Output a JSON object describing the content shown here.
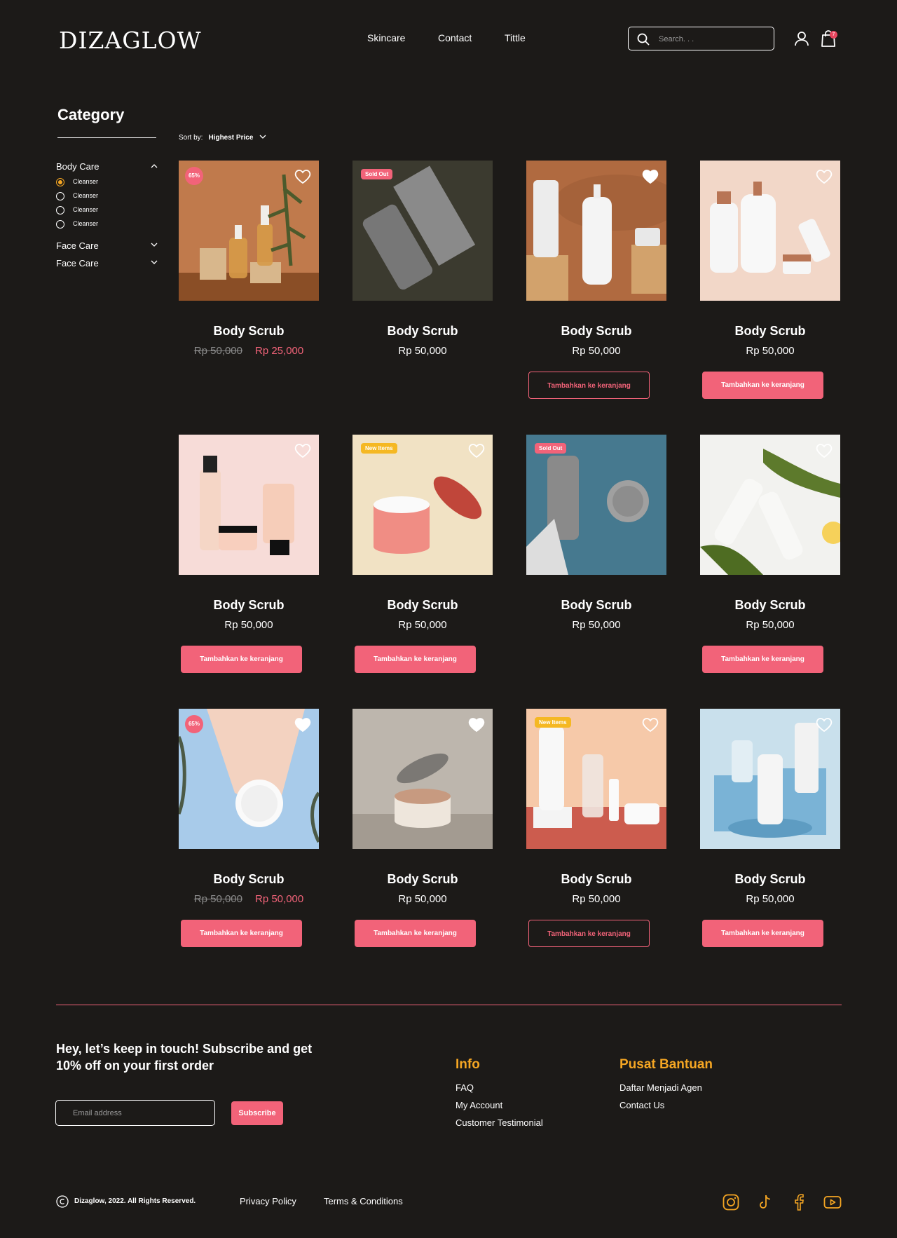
{
  "header": {
    "logo": "DIZAGLOW",
    "nav": [
      "Skincare",
      "Contact",
      "Tittle"
    ],
    "search_placeholder": "Search. . .",
    "cart_count": "7"
  },
  "sidebar": {
    "title": "Category",
    "groups": [
      {
        "label": "Body Care",
        "expanded": true,
        "options": [
          "Cleanser",
          "Cleanser",
          "Cleanser",
          "Cleanser"
        ],
        "selected_index": 0
      },
      {
        "label": "Face Care",
        "expanded": false
      },
      {
        "label": "Face Care",
        "expanded": false
      }
    ]
  },
  "sort": {
    "label": "Sort by:",
    "value": "Highest Price"
  },
  "products": [
    {
      "name": "Body Scrub",
      "old_price": "Rp 50,000",
      "price": "Rp 25,000",
      "badge": "65%",
      "badge_type": "pct",
      "favorited": false,
      "button": null
    },
    {
      "name": "Body Scrub",
      "price": "Rp 50,000",
      "badge": "Sold Out",
      "badge_type": "sold",
      "favorited": null,
      "button": null
    },
    {
      "name": "Body Scrub",
      "price": "Rp 50,000",
      "badge": null,
      "favorited": true,
      "button": "Tambahkan ke keranjang",
      "button_style": "outline"
    },
    {
      "name": "Body Scrub",
      "price": "Rp 50,000",
      "badge": null,
      "favorited": false,
      "button": "Tambahkan ke keranjang",
      "button_style": "fill"
    },
    {
      "name": "Body Scrub",
      "price": "Rp 50,000",
      "badge": null,
      "favorited": false,
      "button": "Tambahkan ke keranjang",
      "button_style": "fill"
    },
    {
      "name": "Body Scrub",
      "price": "Rp 50,000",
      "badge": "New Items",
      "badge_type": "new",
      "favorited": false,
      "button": "Tambahkan ke keranjang",
      "button_style": "fill"
    },
    {
      "name": "Body Scrub",
      "price": "Rp 50,000",
      "badge": "Sold Out",
      "badge_type": "sold",
      "favorited": null,
      "button": null
    },
    {
      "name": "Body Scrub",
      "price": "Rp 50,000",
      "badge": null,
      "favorited": false,
      "button": "Tambahkan ke keranjang",
      "button_style": "fill"
    },
    {
      "name": "Body Scrub",
      "old_price": "Rp 50,000",
      "price": "Rp 50,000",
      "badge": "65%",
      "badge_type": "pct",
      "favorited": true,
      "button": "Tambahkan ke keranjang",
      "button_style": "fill"
    },
    {
      "name": "Body Scrub",
      "price": "Rp 50,000",
      "badge": null,
      "favorited": true,
      "button": "Tambahkan ke keranjang",
      "button_style": "fill"
    },
    {
      "name": "Body Scrub",
      "price": "Rp 50,000",
      "badge": "New Items",
      "badge_type": "new",
      "favorited": false,
      "button": "Tambahkan ke keranjang",
      "button_style": "outline"
    },
    {
      "name": "Body Scrub",
      "price": "Rp 50,000",
      "badge": null,
      "favorited": false,
      "button": "Tambahkan ke keranjang",
      "button_style": "fill"
    }
  ],
  "footer": {
    "keep_in_touch": "Hey, let’s keep in touch! Subscribe and get 10% off on your first order",
    "email_placeholder": "Email address",
    "subscribe": "Subscribe",
    "info_title": "Info",
    "info_links": [
      "FAQ",
      "My Account",
      "Customer Testimonial"
    ],
    "help_title": "Pusat Bantuan",
    "help_links": [
      "Daftar Menjadi Agen",
      "Contact Us"
    ],
    "copyright": "Dizaglow, 2022. All Rights Reserved.",
    "legal": [
      "Privacy Policy",
      "Terms & Conditions"
    ],
    "social_icons": [
      "instagram-icon",
      "tiktok-icon",
      "facebook-icon",
      "youtube-icon"
    ]
  },
  "colors": {
    "background": "#1c1a18",
    "accent": "#f26379",
    "highlight": "#f5a623",
    "new_badge": "#f5b823"
  }
}
